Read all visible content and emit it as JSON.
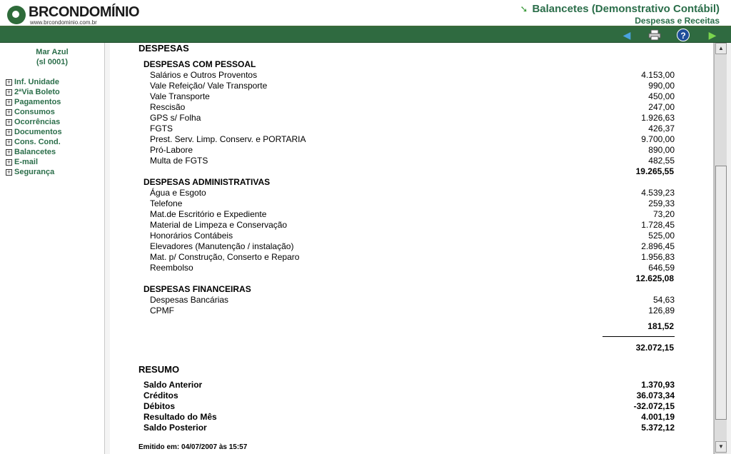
{
  "header": {
    "logo_text": "BRCONDOMÍNIO",
    "logo_url": "www.brcondominio.com.br",
    "title": "Balancetes (Demonstrativo Contábil)",
    "subtitle": "Despesas e Receitas"
  },
  "toolbar": {
    "icons": [
      "back-icon",
      "print-icon",
      "help-icon",
      "forward-icon"
    ],
    "help_glyph": "?"
  },
  "sidebar": {
    "condo_name": "Mar Azul",
    "condo_unit": "(sl 0001)",
    "items": [
      {
        "label": "Inf. Unidade"
      },
      {
        "label": "2ªVia Boleto"
      },
      {
        "label": "Pagamentos"
      },
      {
        "label": "Consumos"
      },
      {
        "label": "Ocorrências"
      },
      {
        "label": "Documentos"
      },
      {
        "label": "Cons. Cond."
      },
      {
        "label": "Balancetes"
      },
      {
        "label": "E-mail"
      },
      {
        "label": "Segurança"
      }
    ]
  },
  "report": {
    "section_title": "DESPESAS",
    "groups": [
      {
        "title": "DESPESAS COM PESSOAL",
        "items": [
          {
            "label": "Salários e Outros Proventos",
            "value": "4.153,00"
          },
          {
            "label": "Vale Refeição/ Vale Transporte",
            "value": "990,00"
          },
          {
            "label": "Vale Transporte",
            "value": "450,00"
          },
          {
            "label": "Rescisão",
            "value": "247,00"
          },
          {
            "label": "GPS s/ Folha",
            "value": "1.926,63"
          },
          {
            "label": "FGTS",
            "value": "426,37"
          },
          {
            "label": "Prest. Serv. Limp. Conserv. e PORTARIA",
            "value": "9.700,00"
          },
          {
            "label": "Pró-Labore",
            "value": "890,00"
          },
          {
            "label": "Multa de FGTS",
            "value": "482,55"
          }
        ],
        "subtotal": "19.265,55"
      },
      {
        "title": "DESPESAS ADMINISTRATIVAS",
        "items": [
          {
            "label": "Água e Esgoto",
            "value": "4.539,23"
          },
          {
            "label": "Telefone",
            "value": "259,33"
          },
          {
            "label": "Mat.de Escritório e Expediente",
            "value": "73,20"
          },
          {
            "label": "Material de Limpeza e Conservação",
            "value": "1.728,45"
          },
          {
            "label": "Honorários Contábeis",
            "value": "525,00"
          },
          {
            "label": "Elevadores (Manutenção / instalação)",
            "value": "2.896,45"
          },
          {
            "label": "Mat. p/ Construção, Conserto e Reparo",
            "value": "1.956,83"
          },
          {
            "label": "Reembolso",
            "value": "646,59"
          }
        ],
        "subtotal": "12.625,08"
      },
      {
        "title": "DESPESAS FINANCEIRAS",
        "items": [
          {
            "label": "Despesas Bancárias",
            "value": "54,63"
          },
          {
            "label": "CPMF",
            "value": "126,89"
          }
        ],
        "subtotal": "181,52"
      }
    ],
    "total": "32.072,15",
    "resumo_title": "RESUMO",
    "resumo": [
      {
        "label": "Saldo Anterior",
        "value": "1.370,93"
      },
      {
        "label": "Créditos",
        "value": "36.073,34"
      },
      {
        "label": "Débitos",
        "value": "-32.072,15"
      },
      {
        "label": "Resultado do Mês",
        "value": "4.001,19"
      },
      {
        "label": "Saldo Posterior",
        "value": "5.372,12"
      }
    ],
    "emitted": "Emitido em: 04/07/2007 às 15:57"
  },
  "colors": {
    "brand_green": "#2b6e4a",
    "toolbar_green": "#2f6a40"
  }
}
